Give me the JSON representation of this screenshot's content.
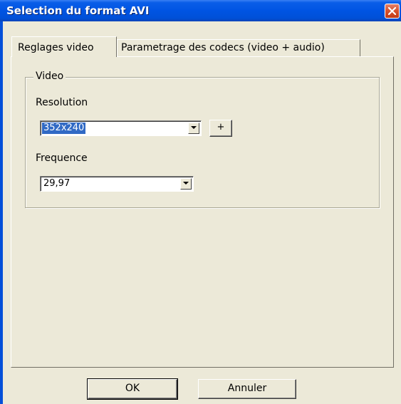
{
  "window": {
    "title": "Selection du format AVI",
    "close_icon": "close-x-icon"
  },
  "tabs": [
    {
      "label": "Reglages video",
      "active": true
    },
    {
      "label": "Parametrage des codecs (video + audio)",
      "active": false
    }
  ],
  "video_group": {
    "legend": "Video",
    "resolution_label": "Resolution",
    "resolution_value": "352x240",
    "add_button_label": "+",
    "frequence_label": "Frequence",
    "frequence_value": "29,97"
  },
  "buttons": {
    "ok_label": "OK",
    "cancel_label": "Annuler"
  },
  "colors": {
    "titlebar": "#0054e3",
    "selection": "#316ac5",
    "face": "#ece9d8"
  }
}
